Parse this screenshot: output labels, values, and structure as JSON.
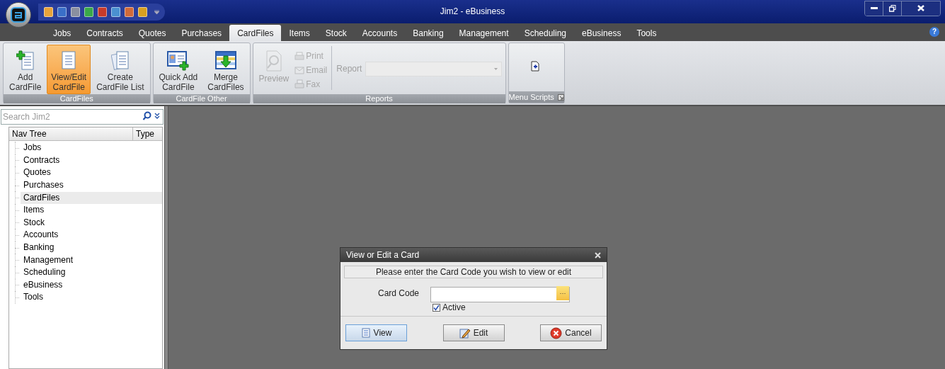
{
  "window": {
    "title": "Jim2 - eBusiness"
  },
  "tabs": [
    {
      "label": "Jobs",
      "selected": false
    },
    {
      "label": "Contracts",
      "selected": false
    },
    {
      "label": "Quotes",
      "selected": false
    },
    {
      "label": "Purchases",
      "selected": false
    },
    {
      "label": "CardFiles",
      "selected": true
    },
    {
      "label": "Items",
      "selected": false
    },
    {
      "label": "Stock",
      "selected": false
    },
    {
      "label": "Accounts",
      "selected": false
    },
    {
      "label": "Banking",
      "selected": false
    },
    {
      "label": "Management",
      "selected": false
    },
    {
      "label": "Scheduling",
      "selected": false
    },
    {
      "label": "eBusiness",
      "selected": false
    },
    {
      "label": "Tools",
      "selected": false
    }
  ],
  "ribbon": {
    "groups": [
      {
        "label": "CardFiles",
        "items": [
          {
            "kind": "large",
            "label": "Add\nCardFile",
            "selected": false
          },
          {
            "kind": "large",
            "label": "View/Edit\nCardFile",
            "selected": true
          },
          {
            "kind": "large",
            "label": "Create\nCardFile List",
            "selected": false
          }
        ]
      },
      {
        "label": "CardFile Other",
        "items": [
          {
            "kind": "large",
            "label": "Quick Add\nCardFile",
            "selected": false
          },
          {
            "kind": "large",
            "label": "Merge\nCardFiles",
            "selected": false
          }
        ]
      },
      {
        "label": "Reports",
        "items": [
          {
            "kind": "large",
            "label": "Preview",
            "disabled": true
          },
          {
            "kind": "stack",
            "buttons": [
              {
                "label": "Print",
                "disabled": true
              },
              {
                "label": "Email",
                "disabled": true
              },
              {
                "label": "Fax",
                "disabled": true
              }
            ]
          },
          {
            "kind": "combo",
            "label": "Report",
            "disabled": true
          }
        ]
      },
      {
        "label": "Menu Scripts",
        "launcher": true,
        "items": [
          {
            "kind": "icon"
          }
        ]
      }
    ]
  },
  "help_button": "?",
  "search": {
    "placeholder": "Search Jim2"
  },
  "nav_tree": {
    "columns": [
      "Nav Tree",
      "Type"
    ],
    "items": [
      {
        "label": "Jobs",
        "selected": false
      },
      {
        "label": "Contracts",
        "selected": false
      },
      {
        "label": "Quotes",
        "selected": false
      },
      {
        "label": "Purchases",
        "selected": false
      },
      {
        "label": "CardFiles",
        "selected": true
      },
      {
        "label": "Items",
        "selected": false
      },
      {
        "label": "Stock",
        "selected": false
      },
      {
        "label": "Accounts",
        "selected": false
      },
      {
        "label": "Banking",
        "selected": false
      },
      {
        "label": "Management",
        "selected": false
      },
      {
        "label": "Scheduling",
        "selected": false
      },
      {
        "label": "eBusiness",
        "selected": false
      },
      {
        "label": "Tools",
        "selected": false
      }
    ]
  },
  "dialog": {
    "title": "View or Edit a Card",
    "instruction": "Please enter the Card Code you wish to view or edit",
    "field_label": "Card Code",
    "field_button": "···",
    "checkbox": {
      "label": "Active",
      "checked": true
    },
    "buttons": [
      {
        "kind": "view",
        "label": "View",
        "selected": true
      },
      {
        "kind": "edit",
        "label": "Edit",
        "selected": false
      },
      {
        "kind": "cancel",
        "label": "Cancel",
        "selected": false
      }
    ]
  }
}
